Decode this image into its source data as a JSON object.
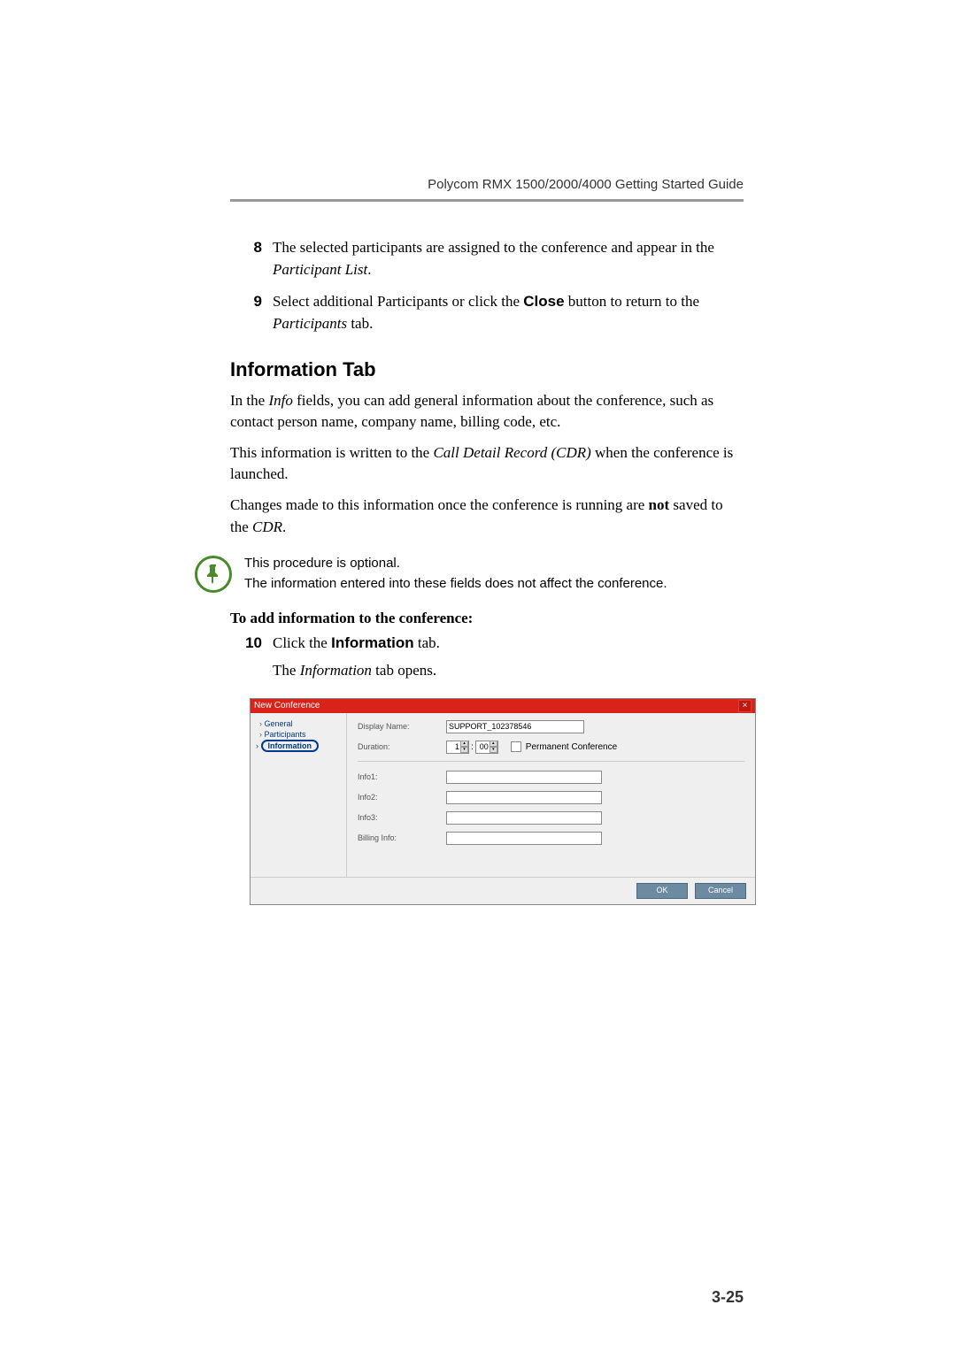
{
  "header": "Polycom RMX 1500/2000/4000 Getting Started Guide",
  "steps": {
    "s8": {
      "num": "8",
      "pre": "The selected participants are assigned to the conference and appear in the ",
      "ital": "Participant List",
      "post": "."
    },
    "s9": {
      "num": "9",
      "pre": "Select additional Participants or click the ",
      "bold": "Close",
      "mid": " button to return to the ",
      "ital": "Participants",
      "post": " tab."
    }
  },
  "section_title": "Information Tab",
  "para1": {
    "pre": "In the ",
    "ital": "Info",
    "post": " fields, you can add general information about the conference, such as contact person name, company name, billing code, etc."
  },
  "para2": {
    "pre": "This information is written to the ",
    "ital": "Call Detail Record (CDR)",
    "post": " when the conference is launched."
  },
  "para3": {
    "pre": "Changes made to this information once the conference is running are ",
    "bold": "not",
    "mid": " saved to the ",
    "ital": "CDR",
    "post": "."
  },
  "note": {
    "line1": "This procedure is optional.",
    "line2": "The information entered into these fields does not affect the conference."
  },
  "subhead": "To add information to the conference:",
  "step10": {
    "num": "10",
    "pre": "Click the ",
    "bold": "Information",
    "post": " tab."
  },
  "step10_result": {
    "pre": "The ",
    "ital": "Information",
    "post": " tab opens."
  },
  "dialog": {
    "title": "New Conference",
    "side": {
      "general": "General",
      "participants": "Participants",
      "information": "Information"
    },
    "labels": {
      "display_name": "Display Name:",
      "duration": "Duration:",
      "info1": "Info1:",
      "info2": "Info2:",
      "info3": "Info3:",
      "billing": "Billing Info:",
      "permanent": "Permanent Conference"
    },
    "values": {
      "display_name": "SUPPORT_102378546",
      "dur_h": "1",
      "dur_m": "00"
    },
    "buttons": {
      "ok": "OK",
      "cancel": "Cancel"
    }
  },
  "page_num": "3-25"
}
